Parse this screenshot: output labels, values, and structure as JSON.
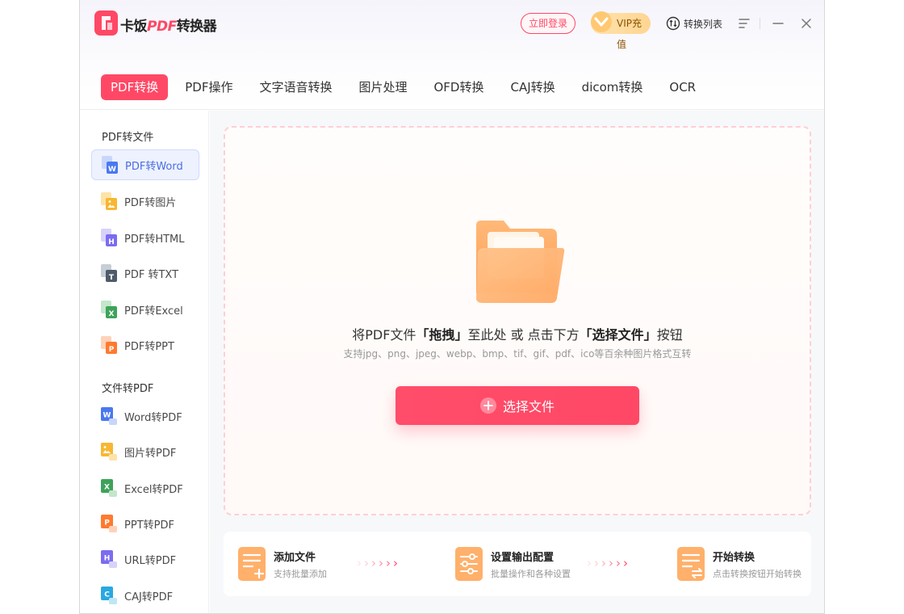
{
  "app": {
    "title_prefix": "卡饭",
    "title_brand": "PDF",
    "title_suffix": "转换器"
  },
  "header": {
    "login_label": "立即登录",
    "vip_label": "VIP充值",
    "convert_list_label": "转换列表"
  },
  "tabs": [
    {
      "label": "PDF转换",
      "active": true
    },
    {
      "label": "PDF操作"
    },
    {
      "label": "文字语音转换"
    },
    {
      "label": "图片处理"
    },
    {
      "label": "OFD转换"
    },
    {
      "label": "CAJ转换"
    },
    {
      "label": "dicom转换"
    },
    {
      "label": "OCR"
    }
  ],
  "sidebar": {
    "group1_title": "PDF转文件",
    "group1_items": [
      {
        "label": "PDF转Word",
        "icon": "word-icon",
        "active": true
      },
      {
        "label": "PDF转图片",
        "icon": "image-icon"
      },
      {
        "label": "PDF转HTML",
        "icon": "html-icon"
      },
      {
        "label": "PDF 转TXT",
        "icon": "txt-icon"
      },
      {
        "label": "PDF转Excel",
        "icon": "excel-icon"
      },
      {
        "label": "PDF转PPT",
        "icon": "ppt-icon"
      }
    ],
    "group2_title": "文件转PDF",
    "group2_items": [
      {
        "label": "Word转PDF",
        "icon": "word-icon"
      },
      {
        "label": "图片转PDF",
        "icon": "image-icon"
      },
      {
        "label": "Excel转PDF",
        "icon": "excel-icon"
      },
      {
        "label": "PPT转PDF",
        "icon": "ppt-icon"
      },
      {
        "label": "URL转PDF",
        "icon": "html-icon"
      },
      {
        "label": "CAJ转PDF",
        "icon": "caj-icon"
      }
    ]
  },
  "dropzone": {
    "hint_pre": "将PDF文件",
    "hint_drag": "「拖拽」",
    "hint_mid": "至此处 或 点击下方",
    "hint_select": "「选择文件」",
    "hint_post": "按钮",
    "formats": "支持jpg、png、jpeg、webp、bmp、tif、gif、pdf、ico等百余种图片格式互转",
    "select_button": "选择文件"
  },
  "steps": [
    {
      "title": "添加文件",
      "sub": "支持批量添加"
    },
    {
      "title": "设置输出配置",
      "sub": "批量操作和各种设置"
    },
    {
      "title": "开始转换",
      "sub": "点击转换按钮开始转换"
    }
  ],
  "colors": {
    "accent": "#ff4866",
    "word": "#4a78f0",
    "image": "#f7b733",
    "html": "#7b6cf0",
    "txt": "#4f5b6b",
    "excel": "#3ea35a",
    "ppt": "#ff7a2f",
    "caj": "#2aa8e0"
  }
}
